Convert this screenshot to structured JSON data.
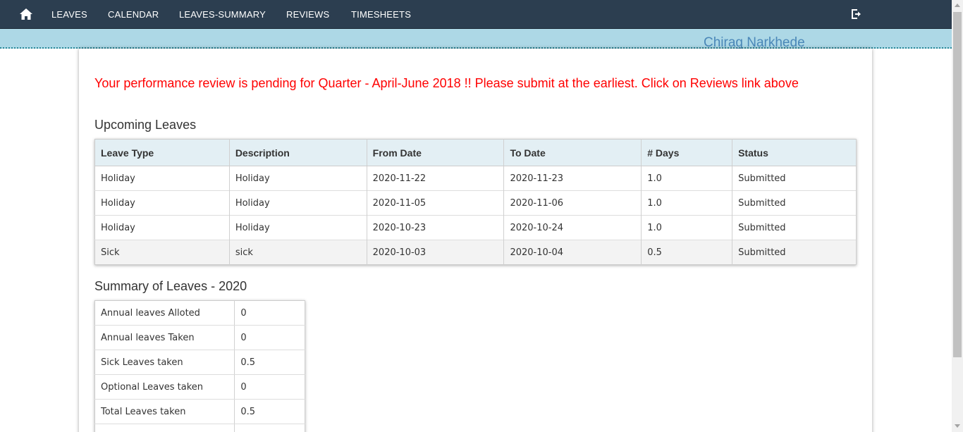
{
  "nav": {
    "home_icon": "home-icon",
    "items": [
      "LEAVES",
      "CALENDAR",
      "LEAVES-SUMMARY",
      "REVIEWS",
      "TIMESHEETS"
    ],
    "logout_icon": "logout-icon"
  },
  "user": {
    "name": "Chirag Narkhede"
  },
  "alert": {
    "text": "Your performance review is pending for Quarter - April-June 2018 !! Please submit at the earliest. Click on Reviews link above"
  },
  "upcoming": {
    "title": "Upcoming Leaves",
    "headers": [
      "Leave Type",
      "Description",
      "From Date",
      "To Date",
      "# Days",
      "Status"
    ],
    "rows": [
      [
        "Holiday",
        "Holiday",
        "2020-11-22",
        "2020-11-23",
        "1.0",
        "Submitted"
      ],
      [
        "Holiday",
        "Holiday",
        "2020-11-05",
        "2020-11-06",
        "1.0",
        "Submitted"
      ],
      [
        "Holiday",
        "Holiday",
        "2020-10-23",
        "2020-10-24",
        "1.0",
        "Submitted"
      ],
      [
        "Sick",
        "sick",
        "2020-10-03",
        "2020-10-04",
        "0.5",
        "Submitted"
      ]
    ]
  },
  "summary": {
    "title": "Summary of Leaves - 2020",
    "rows": [
      [
        "Annual leaves Alloted",
        "0"
      ],
      [
        "Annual leaves Taken",
        "0"
      ],
      [
        "Sick Leaves taken",
        "0.5"
      ],
      [
        "Optional Leaves taken",
        "0"
      ],
      [
        "Total Leaves taken",
        "0.5"
      ]
    ]
  },
  "colors": {
    "navbar": "#2c3e50",
    "userbar": "#add8e6",
    "alert": "#ff0000",
    "username": "#4a87b8"
  }
}
